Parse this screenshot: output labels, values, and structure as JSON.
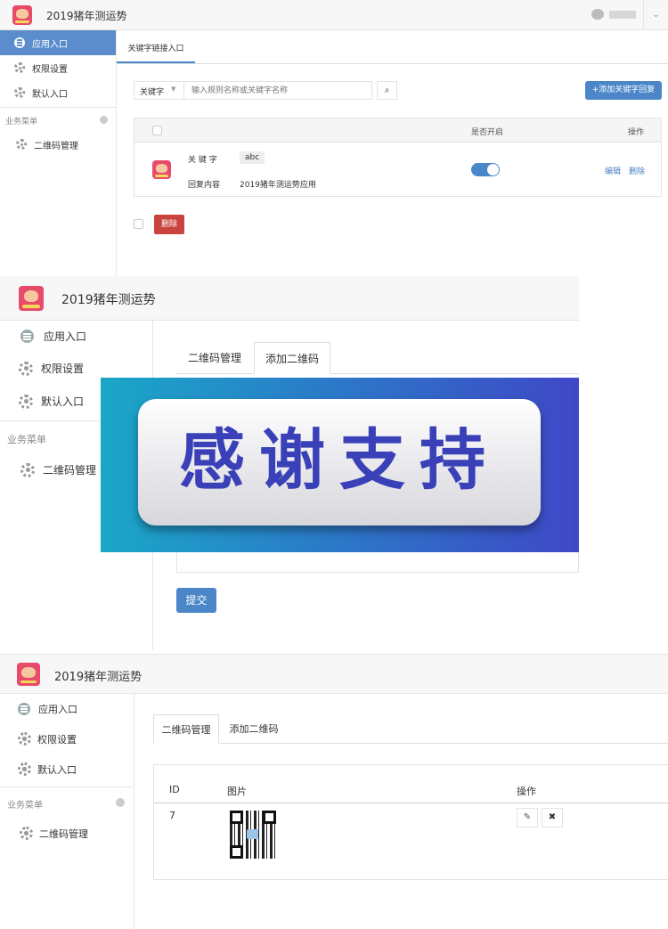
{
  "app": {
    "title": "2019猪年测运势"
  },
  "sidebar": {
    "items": [
      "应用入口",
      "权限设置",
      "默认入口"
    ],
    "group": "业务菜单",
    "group_item": "二维码管理"
  },
  "panel1": {
    "tab": "关键字链接入口",
    "filter_select": "关键字",
    "search_placeholder": "输入规则名称或关键字名称",
    "add_button": "+添加关键字回复",
    "table": {
      "col_status": "是否开启",
      "col_ops": "操作",
      "row": {
        "keyword_label": "关 键 字",
        "keyword_value": "abc",
        "reply_label": "回复内容",
        "reply_value": "2019猪年测运势应用",
        "enabled": true,
        "edit": "编辑",
        "delete": "删除"
      }
    },
    "bulk_delete": "删除"
  },
  "panel2": {
    "tabs": [
      "二维码管理",
      "添加二维码"
    ],
    "overlay_text": "感谢支持",
    "submit": "提交"
  },
  "panel3": {
    "tabs": [
      "二维码管理",
      "添加二维码"
    ],
    "columns": [
      "ID",
      "图片",
      "操作"
    ],
    "rows": [
      {
        "id": "7"
      }
    ]
  },
  "colors": {
    "accent": "#4a86c8",
    "danger": "#c9443f",
    "overlay_start": "#1aa7c8",
    "overlay_end": "#3f47c7"
  }
}
